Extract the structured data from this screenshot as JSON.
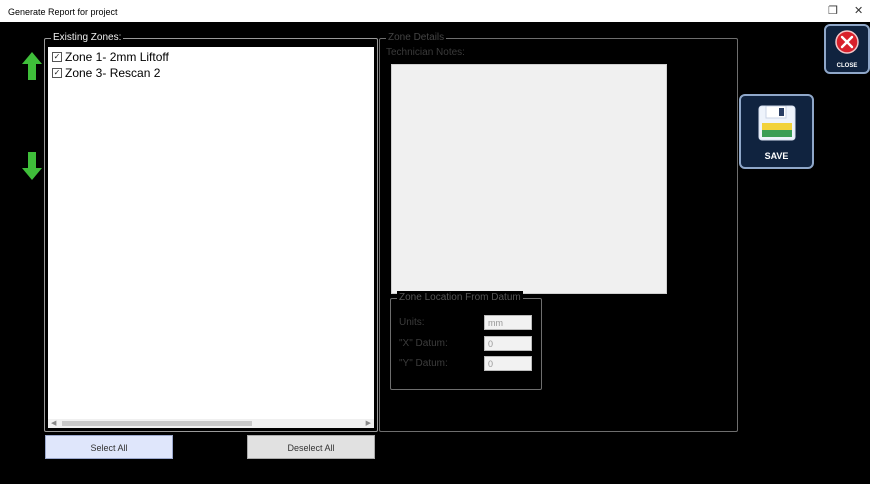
{
  "window": {
    "title": "Generate Report for project",
    "restore_glyph": "❐",
    "close_glyph": "✕"
  },
  "nav": {
    "up_icon": "arrow-up-green",
    "down_icon": "arrow-down-green"
  },
  "zones": {
    "label": "Existing Zones:",
    "items": [
      {
        "label": "Zone 1- 2mm Liftoff",
        "checked": true
      },
      {
        "label": "Zone 3- Rescan 2",
        "checked": true
      }
    ],
    "check_glyph": "✓"
  },
  "details": {
    "label": "Zone Details",
    "notes_label": "Technician Notes:",
    "location": {
      "label": "Zone Location From Datum",
      "units_label": "Units:",
      "units_value": "mm",
      "x_label": "\"X\" Datum:",
      "x_value": "0",
      "y_label": "\"Y\" Datum:",
      "y_value": "0"
    }
  },
  "buttons": {
    "select_all": "Select All",
    "deselect_all": "Deselect All",
    "close": "CLOSE",
    "save": "SAVE"
  },
  "colors": {
    "arrow_green": "#3fbe3a",
    "close_red": "#d9202b",
    "panel_navy": "#10233f"
  }
}
